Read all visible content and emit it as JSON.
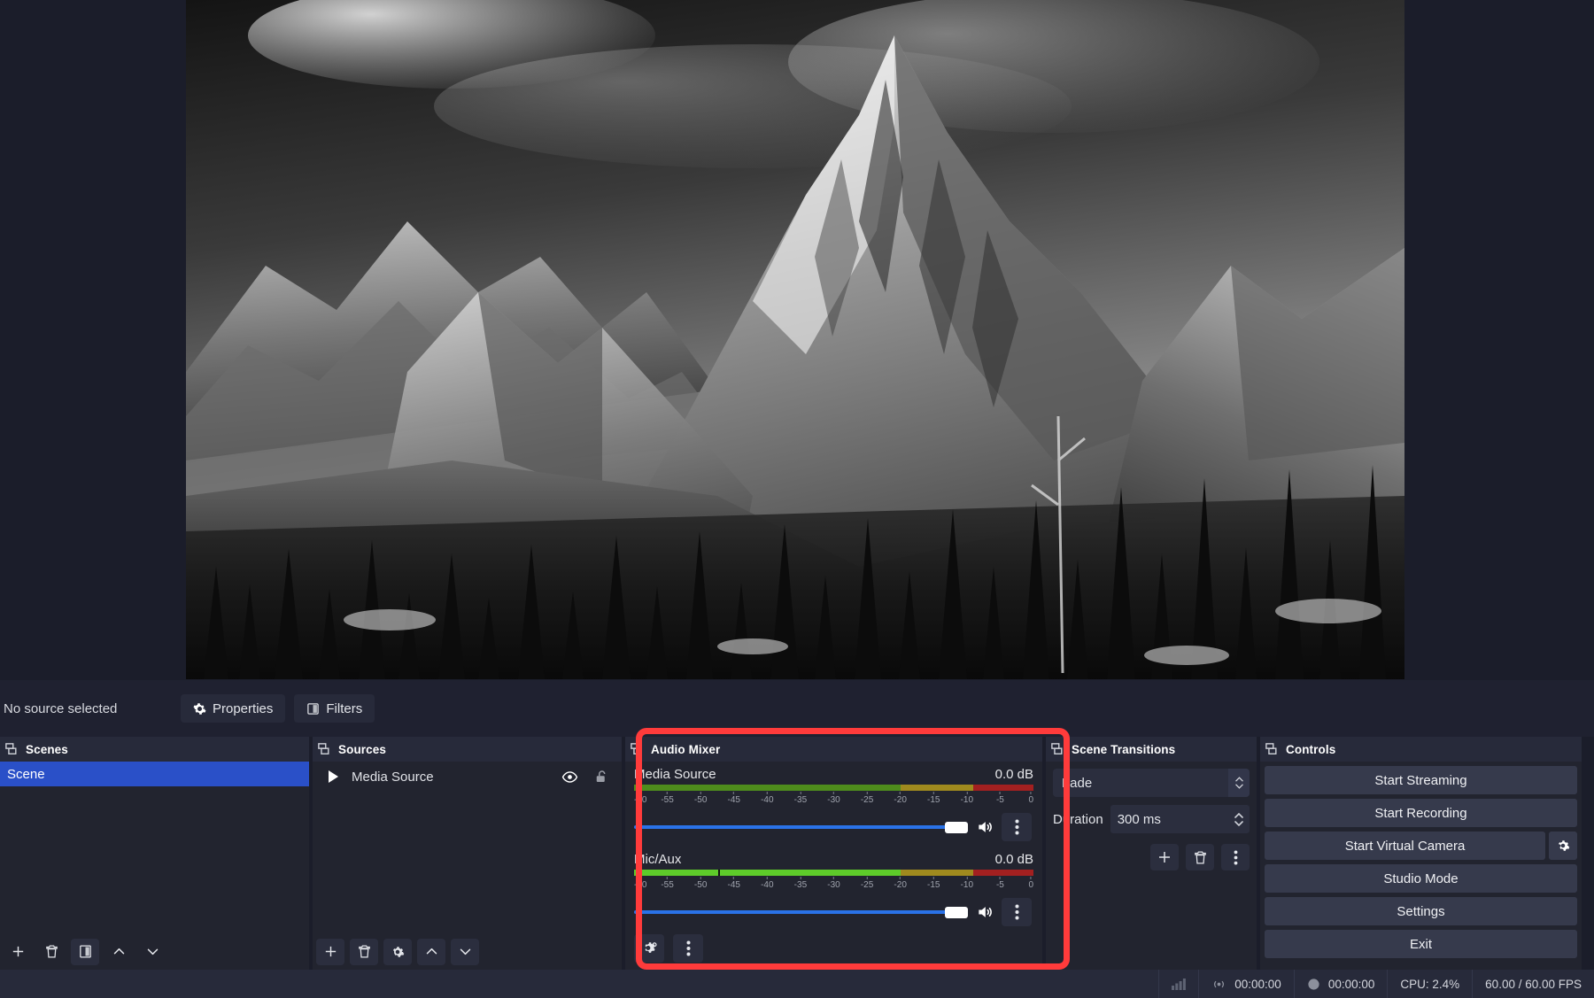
{
  "preview": {
    "alt": "mountain-landscape-grayscale"
  },
  "source_bar": {
    "status": "No source selected",
    "properties_label": "Properties",
    "filters_label": "Filters"
  },
  "scenes": {
    "title": "Scenes",
    "items": [
      {
        "label": "Scene",
        "selected": true
      }
    ],
    "toolbar": [
      "add-icon",
      "remove-icon",
      "scene-filters-icon",
      "move-up-icon",
      "move-down-icon"
    ]
  },
  "sources": {
    "title": "Sources",
    "items": [
      {
        "label": "Media Source",
        "visible": true,
        "locked": false
      }
    ],
    "toolbar": [
      "add-icon",
      "remove-icon",
      "properties-gear-icon",
      "move-up-icon",
      "move-down-icon"
    ]
  },
  "audio_mixer": {
    "title": "Audio Mixer",
    "highlighted": true,
    "highlight_color": "#ff3b3b",
    "tick_labels": [
      "-60",
      "-55",
      "-50",
      "-45",
      "-40",
      "-35",
      "-30",
      "-25",
      "-20",
      "-15",
      "-10",
      "-5",
      "0"
    ],
    "tracks": [
      {
        "name": "Media Source",
        "level_db": "0.0 dB",
        "volume_percent": 100,
        "muted": false,
        "meter": {
          "peak_db": 0,
          "green_end_db": -20,
          "yellow_end_db": -9
        }
      },
      {
        "name": "Mic/Aux",
        "level_db": "0.0 dB",
        "volume_percent": 100,
        "muted": false,
        "meter": {
          "peak_db": 0,
          "green_end_db": -20,
          "yellow_end_db": -9
        }
      }
    ],
    "footer_buttons": [
      "advanced-audio-properties-icon",
      "mixer-menu-icon"
    ]
  },
  "scene_transitions": {
    "title": "Scene Transitions",
    "transition": "Fade",
    "duration_label": "Duration",
    "duration_value": "300 ms",
    "buttons": [
      "add-transition-icon",
      "remove-transition-icon",
      "transition-menu-icon"
    ]
  },
  "controls": {
    "title": "Controls",
    "buttons": [
      {
        "label": "Start Streaming",
        "gear": false
      },
      {
        "label": "Start Recording",
        "gear": false
      },
      {
        "label": "Start Virtual Camera",
        "gear": true
      },
      {
        "label": "Studio Mode",
        "gear": false
      },
      {
        "label": "Settings",
        "gear": false
      },
      {
        "label": "Exit",
        "gear": false
      }
    ]
  },
  "status_bar": {
    "signal_icon": "signal-bars-icon",
    "stream_icon": "broadcast-icon",
    "stream_time": "00:00:00",
    "record_icon": "record-dot-icon",
    "record_time": "00:00:00",
    "cpu": "CPU: 2.4%",
    "fps": "60.00 / 60.00 FPS"
  },
  "colors": {
    "accent_blue": "#2a50c8",
    "slider_blue": "#2a72e8",
    "highlight_red": "#ff3b3b",
    "panel_bg": "#22242f",
    "title_bg": "#272a3a",
    "window_bg": "#1b1d2a"
  }
}
